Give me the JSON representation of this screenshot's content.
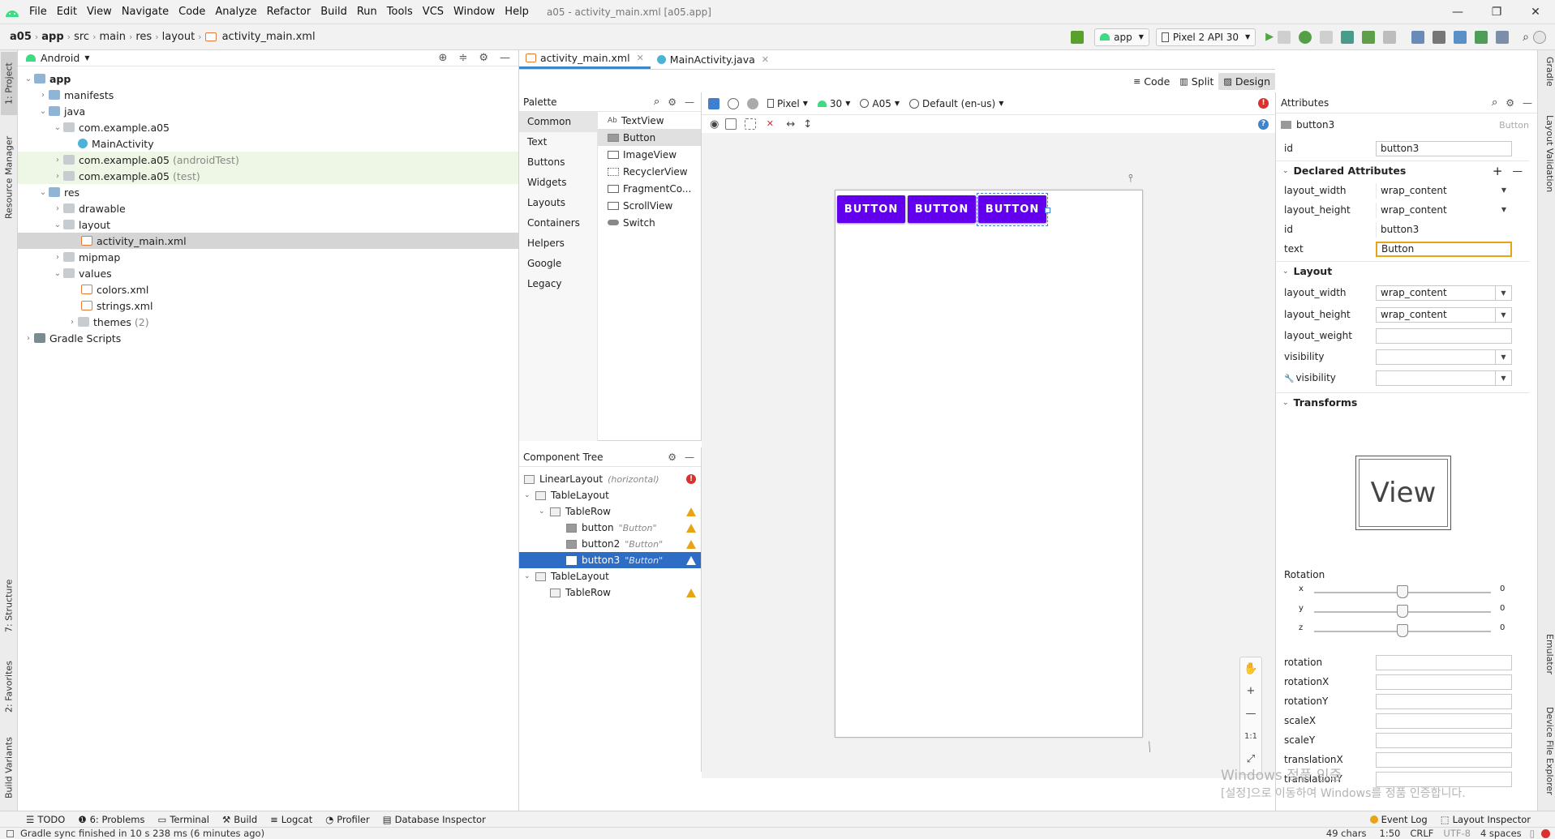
{
  "menubar": {
    "items": [
      "File",
      "Edit",
      "View",
      "Navigate",
      "Code",
      "Analyze",
      "Refactor",
      "Build",
      "Run",
      "Tools",
      "VCS",
      "Window",
      "Help"
    ],
    "window_title": "a05 - activity_main.xml [a05.app]"
  },
  "navbar": {
    "breadcrumbs": [
      "a05",
      "app",
      "src",
      "main",
      "res",
      "layout",
      "activity_main.xml"
    ],
    "run_config": "app",
    "device": "Pixel 2 API 30"
  },
  "left_strip": {
    "project": "1: Project",
    "resource_manager": "Resource Manager",
    "structure": "7: Structure",
    "favorites": "2: Favorites",
    "build_variants": "Build Variants"
  },
  "right_strip": {
    "gradle": "Gradle",
    "layout_validation": "Layout Validation",
    "emulator": "Emulator",
    "device_file_explorer": "Device File Explorer"
  },
  "project": {
    "view_name": "Android",
    "tree": [
      {
        "label": "app",
        "sub": ""
      },
      {
        "label": "manifests",
        "sub": ""
      },
      {
        "label": "java",
        "sub": ""
      },
      {
        "label": "com.example.a05",
        "sub": ""
      },
      {
        "label": "MainActivity",
        "sub": ""
      },
      {
        "label": "com.example.a05",
        "sub": "(androidTest)"
      },
      {
        "label": "com.example.a05",
        "sub": "(test)"
      },
      {
        "label": "res",
        "sub": ""
      },
      {
        "label": "drawable",
        "sub": ""
      },
      {
        "label": "layout",
        "sub": ""
      },
      {
        "label": "activity_main.xml",
        "sub": ""
      },
      {
        "label": "mipmap",
        "sub": ""
      },
      {
        "label": "values",
        "sub": ""
      },
      {
        "label": "colors.xml",
        "sub": ""
      },
      {
        "label": "strings.xml",
        "sub": ""
      },
      {
        "label": "themes",
        "sub": "(2)"
      },
      {
        "label": "Gradle Scripts",
        "sub": ""
      }
    ]
  },
  "editor": {
    "tabs": [
      "activity_main.xml",
      "MainActivity.java"
    ],
    "view_modes": [
      "Code",
      "Split",
      "Design"
    ]
  },
  "palette": {
    "title": "Palette",
    "categories": [
      "Common",
      "Text",
      "Buttons",
      "Widgets",
      "Layouts",
      "Containers",
      "Helpers",
      "Google",
      "Legacy"
    ],
    "items": [
      "TextView",
      "Button",
      "ImageView",
      "RecyclerView",
      "FragmentCo...",
      "ScrollView",
      "Switch"
    ],
    "textview_icon_glyph": "Ab"
  },
  "design_toolbar": {
    "device": "Pixel",
    "api": "30",
    "theme": "A05",
    "locale": "Default (en-us)"
  },
  "component_tree": {
    "title": "Component Tree",
    "rows": [
      {
        "label": "LinearLayout",
        "sub": "(horizontal)"
      },
      {
        "label": "TableLayout",
        "sub": ""
      },
      {
        "label": "TableRow",
        "sub": ""
      },
      {
        "label": "button",
        "sub": "\"Button\""
      },
      {
        "label": "button2",
        "sub": "\"Button\""
      },
      {
        "label": "button3",
        "sub": "\"Button\""
      },
      {
        "label": "TableLayout",
        "sub": ""
      },
      {
        "label": "TableRow",
        "sub": ""
      }
    ]
  },
  "canvas": {
    "buttons": [
      "BUTTON",
      "BUTTON",
      "BUTTON"
    ],
    "button_color": "#6200ee",
    "zoom": {
      "plus": "+",
      "minus": "—",
      "one_to_one": "1:1"
    }
  },
  "attributes": {
    "title": "Attributes",
    "component": "button3",
    "component_type": "Button",
    "id_label": "id",
    "id_value": "button3",
    "declared_title": "Declared Attributes",
    "declared": [
      {
        "name": "layout_width",
        "value": "wrap_content"
      },
      {
        "name": "layout_height",
        "value": "wrap_content"
      },
      {
        "name": "id",
        "value": "button3"
      },
      {
        "name": "text",
        "value": "Button"
      }
    ],
    "layout_title": "Layout",
    "layout": [
      {
        "name": "layout_width",
        "value": "wrap_content"
      },
      {
        "name": "layout_height",
        "value": "wrap_content"
      },
      {
        "name": "layout_weight",
        "value": ""
      },
      {
        "name": "visibility",
        "value": ""
      },
      {
        "name": "visibility",
        "value": ""
      }
    ],
    "transforms_title": "Transforms",
    "preview_text": "View",
    "rotation_title": "Rotation",
    "rotation": [
      {
        "axis": "x",
        "value": "0"
      },
      {
        "axis": "y",
        "value": "0"
      },
      {
        "axis": "z",
        "value": "0"
      }
    ],
    "transform_fields": [
      "rotation",
      "rotationX",
      "rotationY",
      "scaleX",
      "scaleY",
      "translationX",
      "translationY"
    ]
  },
  "bottom_tools": [
    "TODO",
    "6: Problems",
    "Terminal",
    "Build",
    "Logcat",
    "Profiler",
    "Database Inspector",
    "Event Log",
    "Layout Inspector"
  ],
  "status": {
    "message": "Gradle sync finished in 10 s 238 ms (6 minutes ago)",
    "chars": "49 chars",
    "position": "1:50",
    "line_sep": "CRLF",
    "encoding": "UTF-8",
    "indent": "4 spaces"
  },
  "watermark": {
    "line1": "Windows 정품 인증",
    "line2": "[설정]으로 이동하여 Windows를 정품 인증합니다."
  }
}
